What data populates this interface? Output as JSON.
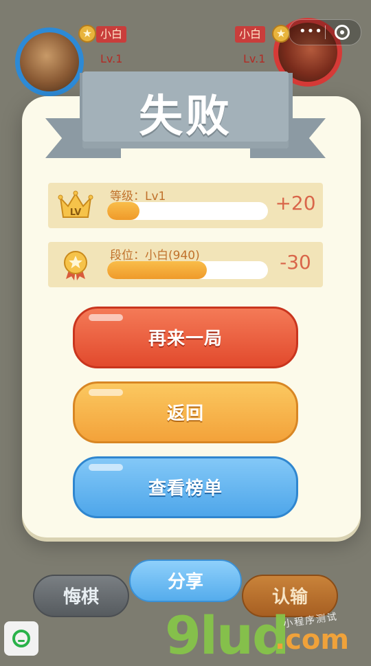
{
  "players": {
    "left": {
      "name": "小白",
      "level": "Lv.1"
    },
    "right": {
      "name": "小白",
      "level": "Lv.1"
    }
  },
  "menu": {
    "more_icon": "three-dots-icon",
    "close_icon": "target-circle-icon"
  },
  "result": {
    "title": "失败"
  },
  "stats": [
    {
      "label": "等级：Lv1",
      "delta": "+20",
      "progress": 0.2,
      "icon": "crown-lv-icon"
    },
    {
      "label": "段位：小白(940)",
      "delta": "-30",
      "progress": 0.62,
      "icon": "star-medal-icon"
    }
  ],
  "buttons": {
    "play_again": "再来一局",
    "back": "返回",
    "leaderboard": "查看榜单"
  },
  "bottom": {
    "undo": "悔棋",
    "share": "分享",
    "surrender": "认输"
  },
  "watermark": {
    "logo": "9lud",
    "domain": ".com",
    "note": "小程序测试"
  },
  "colors": {
    "red_button": "#e24a2d",
    "orange_button": "#f3a23a",
    "blue_button": "#4ea6ea",
    "ribbon": "#a3b1b9",
    "card": "#fcfaea"
  }
}
